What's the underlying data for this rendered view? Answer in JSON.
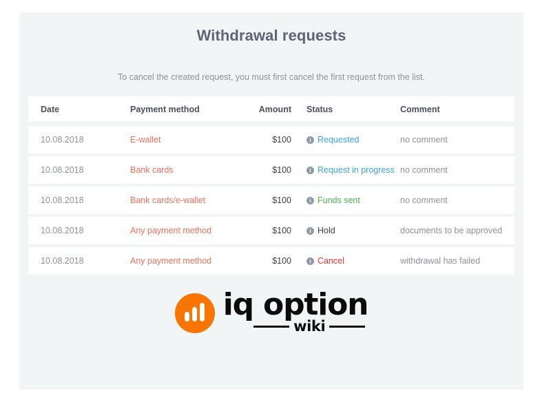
{
  "page": {
    "title": "Withdrawal requests",
    "subtitle": "To cancel the created request, you must first cancel the first request from the list.",
    "title_color": "#5d6478",
    "card_bg": "#f2f5f6"
  },
  "table": {
    "headers": {
      "date": "Date",
      "method": "Payment method",
      "amount": "Amount",
      "status": "Status",
      "comment": "Comment"
    },
    "rows": [
      {
        "date": "10.08.2018",
        "method": "E-wallet",
        "method_2": "",
        "amount": "$100",
        "status_icon": "info-icon",
        "status": "Requested",
        "status_color": "#3aa3e3",
        "comment": "no comment"
      },
      {
        "date": "10.08.2018",
        "method": "Bank cards",
        "method_2": "",
        "amount": "$100",
        "status_icon": "info-icon",
        "status": "Request in progress",
        "status_color": "#3aa3e3",
        "comment": "no comment"
      },
      {
        "date": "10.08.2018",
        "method": "Bank cards",
        "method_2": "e-wallet",
        "amount": "$100",
        "status_icon": "info-icon",
        "status": "Funds sent",
        "status_color": "#4cb050",
        "comment": "no comment"
      },
      {
        "date": "10.08.2018",
        "method": "Any payment method",
        "method_2": "",
        "amount": "$100",
        "status_icon": "info-icon",
        "status": "Hold",
        "status_color": "#3b3f4a",
        "comment": "documents to be approved"
      },
      {
        "date": "10.08.2018",
        "method": "Any payment method",
        "method_2": "",
        "amount": "$100",
        "status_icon": "info-icon",
        "status": "Cancel",
        "status_color": "#f5322e",
        "comment": "withdrawal has failed"
      }
    ]
  },
  "logo": {
    "mark_icon": "bar-chart-circle-icon",
    "mark_color": "#fa7500",
    "word": "iq option",
    "sub": "wiki"
  }
}
